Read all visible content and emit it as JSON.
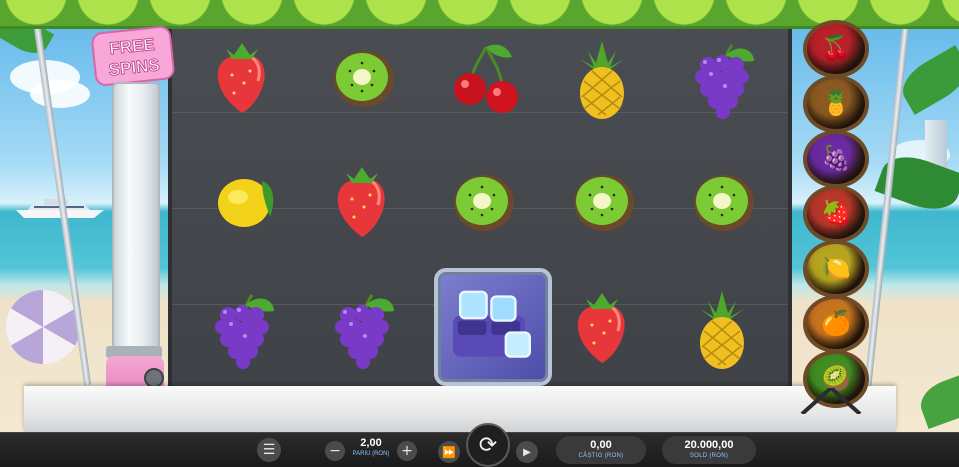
{
  "game": {
    "free_spins_label_line1": "FREE",
    "free_spins_label_line2": "SPINS"
  },
  "reels": [
    [
      "strawberry",
      "lemon",
      "grapes"
    ],
    [
      "kiwi",
      "strawberry",
      "grapes"
    ],
    [
      "cherries",
      "kiwi",
      "ice-tray-wild"
    ],
    [
      "pineapple",
      "kiwi",
      "strawberry"
    ],
    [
      "grapes",
      "kiwi",
      "pineapple"
    ]
  ],
  "paytable_orbs": [
    {
      "symbol": "cherries",
      "glyph": "🍒",
      "ring": "#b8202a"
    },
    {
      "symbol": "pineapple",
      "glyph": "🍍",
      "ring": "#8a5a22"
    },
    {
      "symbol": "grapes",
      "glyph": "🍇",
      "ring": "#6a2aa0"
    },
    {
      "symbol": "strawberry",
      "glyph": "🍓",
      "ring": "#b8362a"
    },
    {
      "symbol": "lemon",
      "glyph": "🍋",
      "ring": "#b7a521"
    },
    {
      "symbol": "orange",
      "glyph": "🍊",
      "ring": "#c8741f"
    },
    {
      "symbol": "kiwi",
      "glyph": "🥝",
      "ring": "#3f8e22"
    }
  ],
  "controls": {
    "menu_glyph": "☰",
    "minus_glyph": "−",
    "plus_glyph": "+",
    "turbo_glyph": "⏩",
    "spin_glyph": "⟳",
    "autoplay_glyph": "▶",
    "bet_value": "2,00",
    "bet_label": "PARIU (RON)",
    "win_value": "0,00",
    "win_label": "CÂȘTIG (RON)",
    "balance_value": "20.000,00",
    "balance_label": "SOLD (RON)"
  }
}
